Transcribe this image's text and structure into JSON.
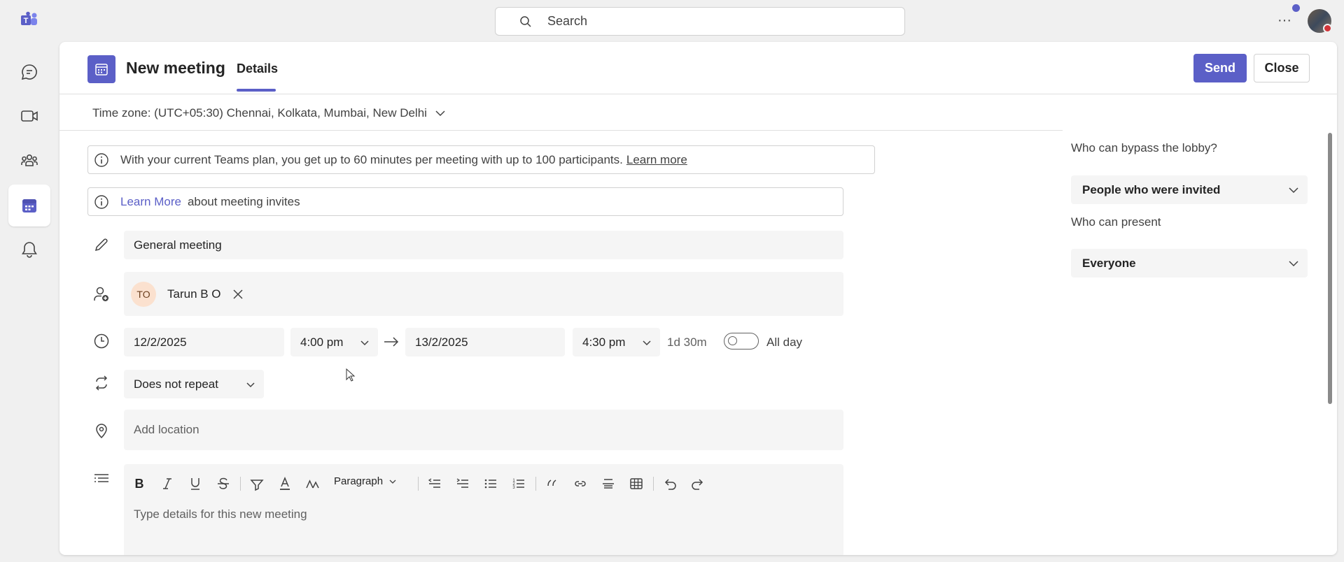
{
  "topbar": {
    "search_placeholder": "Search",
    "more_label": "···"
  },
  "rail": {
    "items": [
      {
        "name": "chat",
        "icon": "chat-icon"
      },
      {
        "name": "meet",
        "icon": "video-icon"
      },
      {
        "name": "communities",
        "icon": "people-icon"
      },
      {
        "name": "calendar",
        "icon": "calendar-icon",
        "active": true
      },
      {
        "name": "activity",
        "icon": "bell-icon"
      }
    ]
  },
  "header": {
    "title": "New meeting",
    "tab": "Details",
    "send_label": "Send",
    "close_label": "Close"
  },
  "timezone": {
    "label": "Time zone: (UTC+05:30) Chennai, Kolkata, Mumbai, New Delhi"
  },
  "banners": {
    "plan_text": "With your current Teams plan, you get up to 60 minutes per meeting with up to 100 participants.",
    "plan_link": "Learn more",
    "invite_link": "Learn More",
    "invite_text": "about meeting invites"
  },
  "form": {
    "title_value": "General meeting",
    "attendee": {
      "initials": "TO",
      "name": "Tarun B O"
    },
    "start_date": "12/2/2025",
    "start_time": "4:00 pm",
    "end_date": "13/2/2025",
    "end_time": "4:30 pm",
    "duration": "1d 30m",
    "all_day_label": "All day",
    "all_day_on": false,
    "repeat": "Does not repeat",
    "location_placeholder": "Add location",
    "details_placeholder": "Type details for this new meeting",
    "paragraph_style": "Paragraph"
  },
  "side": {
    "lobby_label": "Who can bypass the lobby?",
    "lobby_value": "People who were invited",
    "present_label": "Who can present",
    "present_value": "Everyone"
  },
  "colors": {
    "accent": "#5b5fc7",
    "status_busy": "#d13438"
  }
}
